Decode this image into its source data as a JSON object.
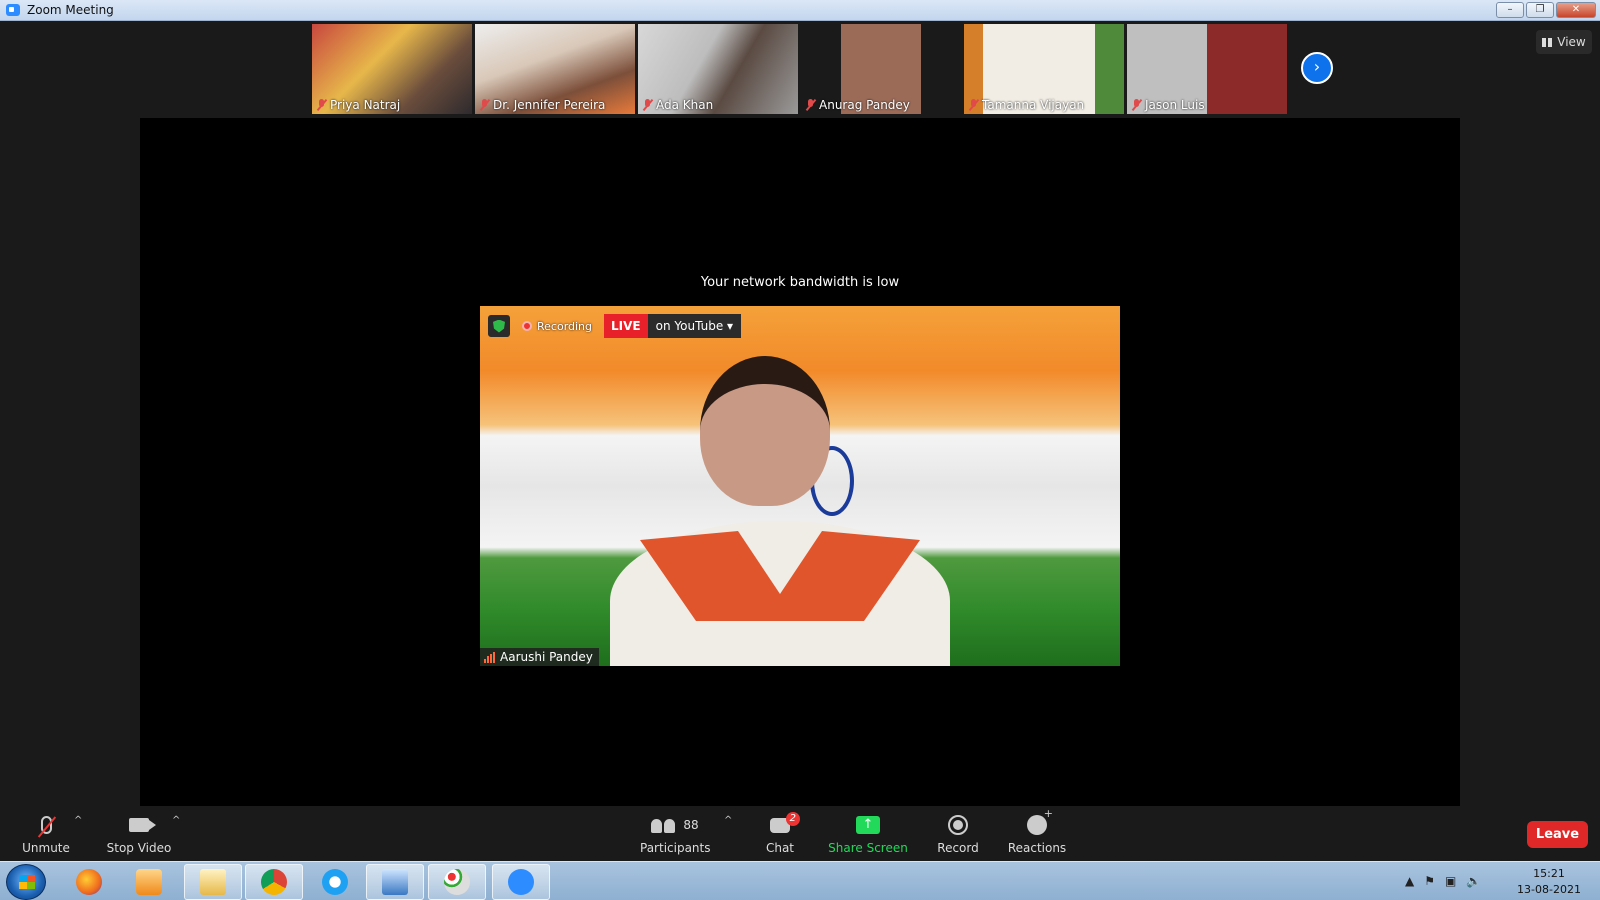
{
  "window": {
    "title": "Zoom Meeting"
  },
  "participants_strip": [
    {
      "name": "Priya Natraj"
    },
    {
      "name": "Dr. Jennifer Pereira"
    },
    {
      "name": "Ada Khan"
    },
    {
      "name": "Anurag Pandey"
    },
    {
      "name": "Tamanna Vijayan"
    },
    {
      "name": "Jason Luis"
    }
  ],
  "view_button": {
    "label": "View"
  },
  "network_warning": "Your network bandwidth is low",
  "speaker": {
    "name": "Aarushi Pandey",
    "recording_label": "Recording",
    "live_label": "LIVE",
    "stream_label": "on YouTube ▾"
  },
  "toolbar": {
    "unmute": "Unmute",
    "stop_video": "Stop Video",
    "participants": "Participants",
    "participants_count": "88",
    "chat": "Chat",
    "chat_badge": "2",
    "share_screen": "Share Screen",
    "record": "Record",
    "reactions": "Reactions",
    "leave": "Leave"
  },
  "taskbar": {
    "time": "15:21",
    "date": "13-08-2021"
  },
  "colors": {
    "accent": "#0e72ed",
    "leave": "#e02828",
    "share": "#23d959",
    "live": "#e8202a"
  }
}
